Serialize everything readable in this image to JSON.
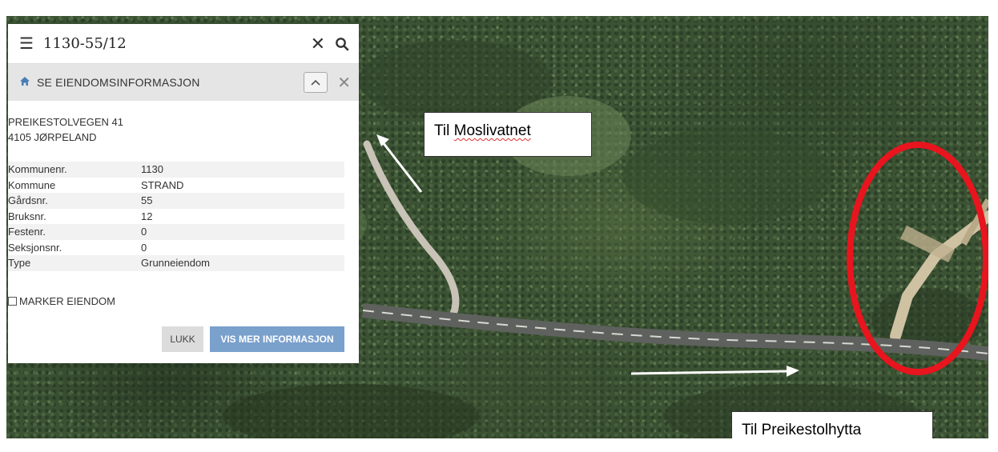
{
  "search": {
    "query": "1130-55/12",
    "menu_icon": "hamburger-icon",
    "clear_icon": "close-icon",
    "search_icon": "search-icon"
  },
  "section": {
    "title": "SE EIENDOMSINFORMASJON",
    "home_icon": "home-icon",
    "collapse_icon": "chevron-up-icon",
    "close_icon": "close-icon"
  },
  "address": {
    "line1": "PREIKESTOLVEGEN 41",
    "line2": "4105 JØRPELAND"
  },
  "attributes": [
    {
      "key": "Kommunenr.",
      "value": "1130"
    },
    {
      "key": "Kommune",
      "value": "STRAND"
    },
    {
      "key": "Gårdsnr.",
      "value": "55"
    },
    {
      "key": "Bruksnr.",
      "value": "12"
    },
    {
      "key": "Festenr.",
      "value": "0"
    },
    {
      "key": "Seksjonsnr.",
      "value": "0"
    },
    {
      "key": "Type",
      "value": "Grunneiendom"
    }
  ],
  "marker": {
    "label": "MARKER EIENDOM",
    "checked": false
  },
  "buttons": {
    "close": "LUKK",
    "more": "VIS MER INFORMASJON"
  },
  "annotations": {
    "to_lake": "Til Moslivatnet",
    "to_lake_prefix": "Til ",
    "to_lake_word": "Moslivatnet",
    "to_hut": "Til Preikestolhytta"
  },
  "colors": {
    "highlight": "#e8141e",
    "accent": "#7aa0cc",
    "header_bg": "#e5e5e5"
  }
}
